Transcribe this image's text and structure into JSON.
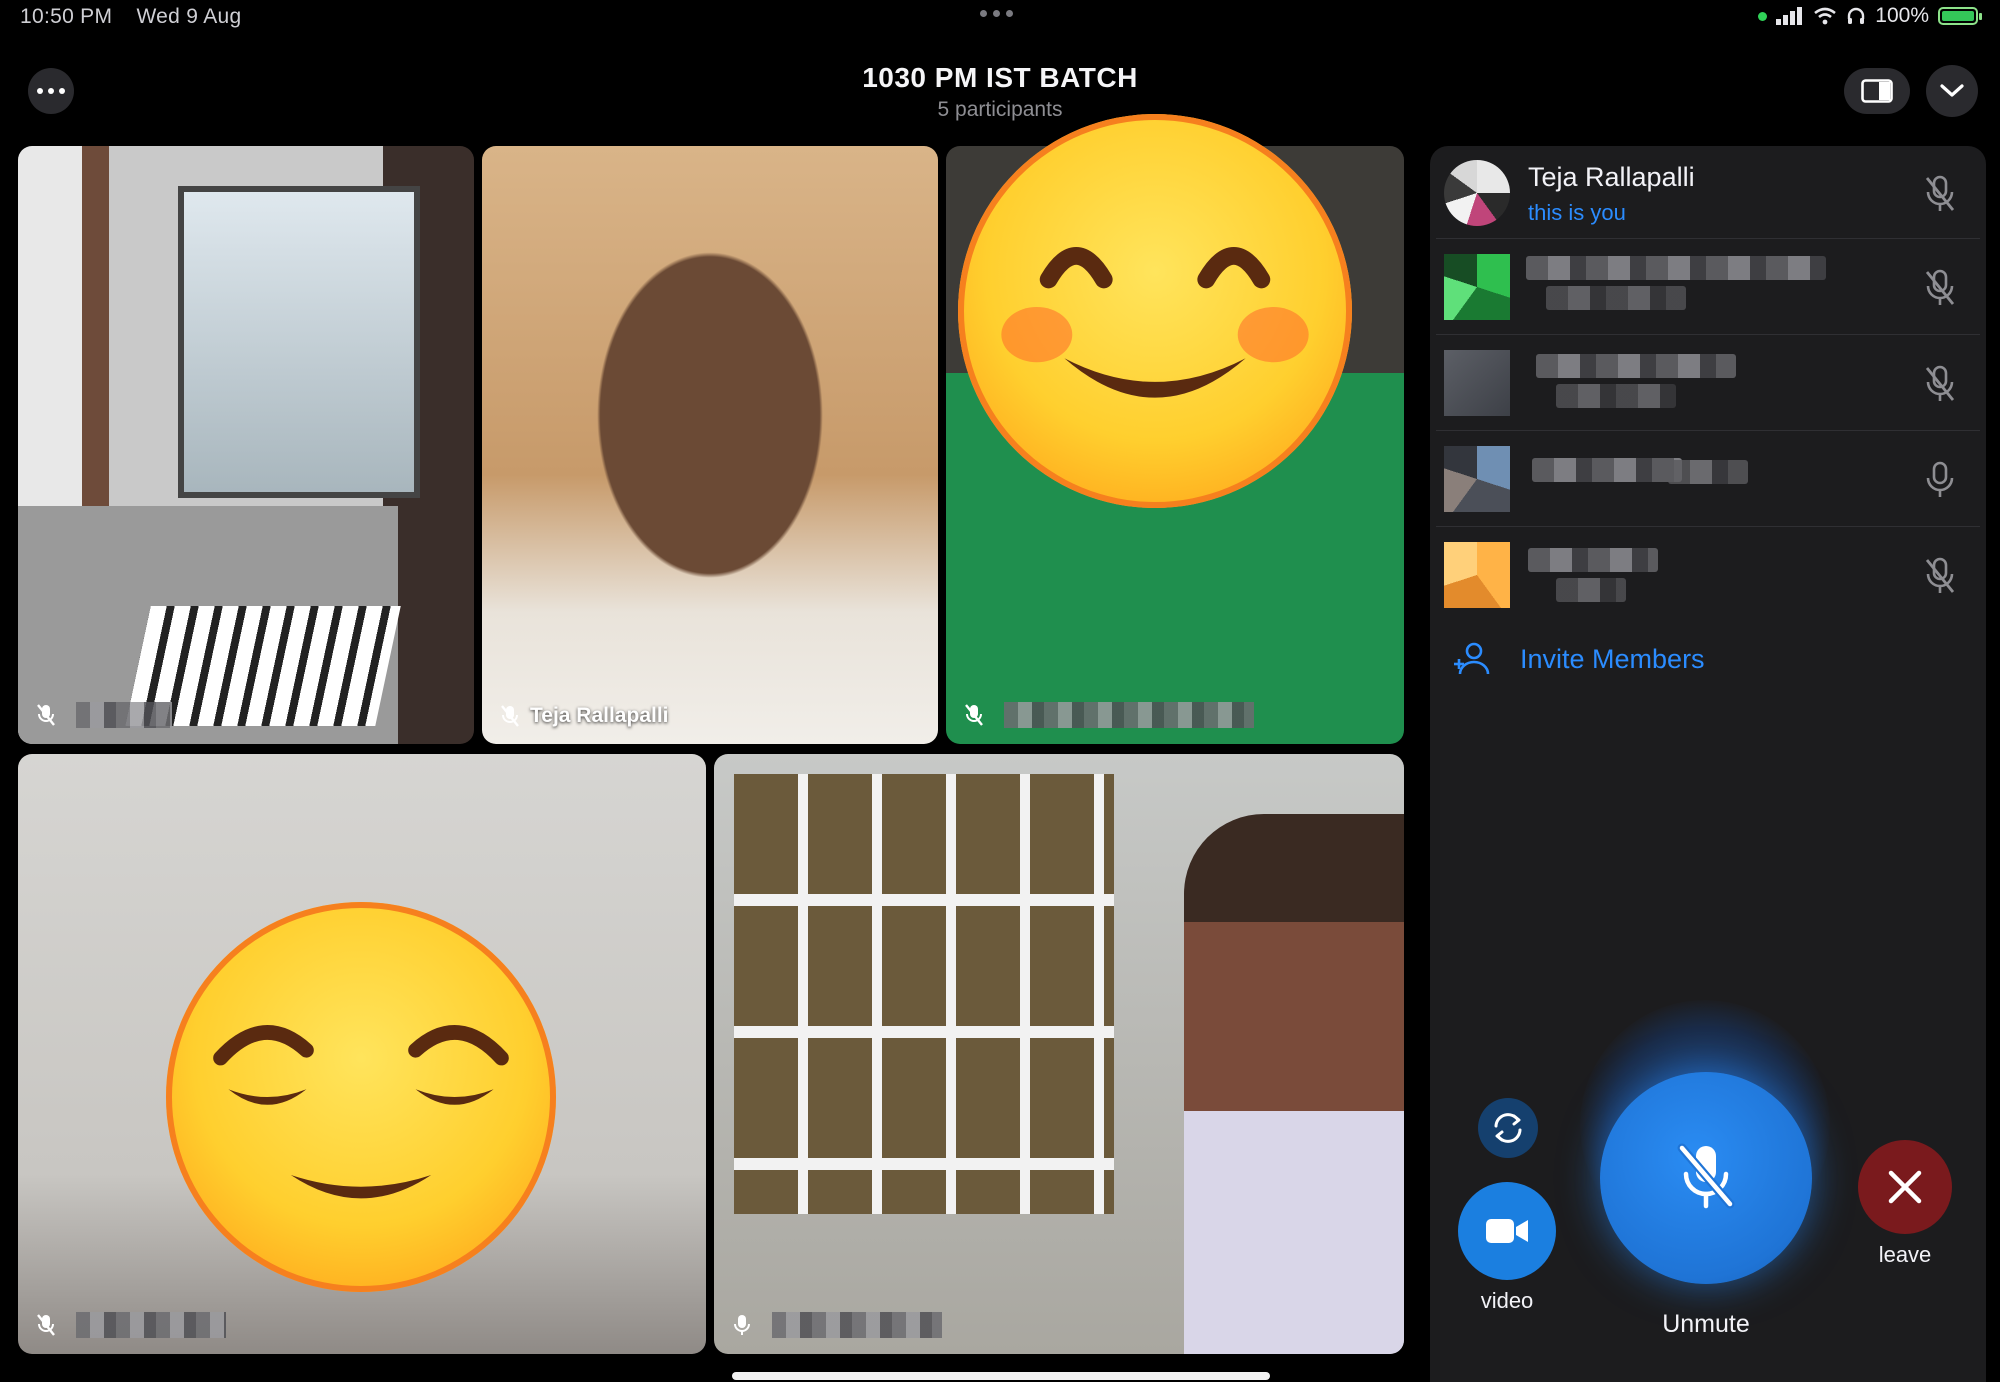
{
  "status_bar": {
    "time": "10:50 PM",
    "date": "Wed 9 Aug",
    "battery": "100%"
  },
  "call": {
    "title": "1030 PM IST BATCH",
    "subtitle": "5 participants"
  },
  "tiles": [
    {
      "name": "",
      "muted": true
    },
    {
      "name": "Teja Rallapalli",
      "muted": true
    },
    {
      "name": "",
      "muted": true
    },
    {
      "name": "",
      "muted": true
    },
    {
      "name": "",
      "muted": false
    }
  ],
  "participants": [
    {
      "name": "Teja Rallapalli",
      "subtitle": "this is you",
      "muted": true
    },
    {
      "name": "",
      "subtitle": "",
      "muted": true
    },
    {
      "name": "",
      "subtitle": "",
      "muted": true
    },
    {
      "name": "",
      "subtitle": "",
      "muted": false
    },
    {
      "name": "",
      "subtitle": "",
      "muted": true
    }
  ],
  "invite": {
    "label": "Invite Members"
  },
  "controls": {
    "video_label": "video",
    "unmute_label": "Unmute",
    "leave_label": "leave"
  },
  "colors": {
    "accent_blue": "#2b8cff",
    "leave_red": "#7a1a1d",
    "panel_bg": "#1c1c1e"
  }
}
